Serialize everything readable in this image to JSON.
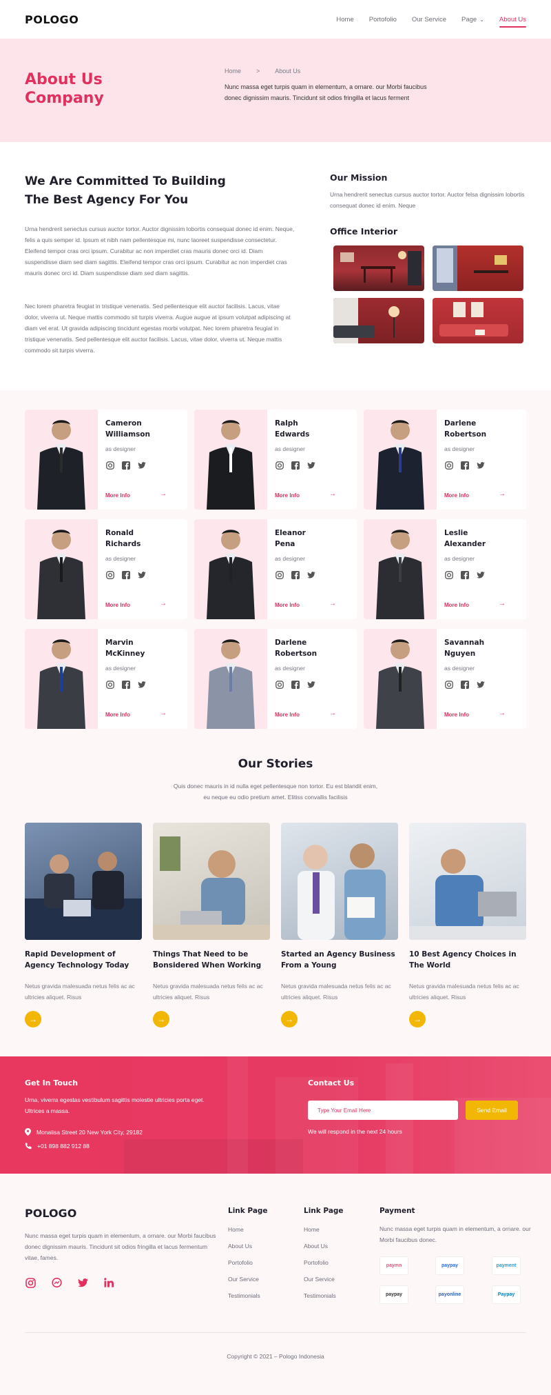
{
  "header": {
    "logo": "POLOGO",
    "nav": [
      {
        "label": "Home"
      },
      {
        "label": "Portofolio"
      },
      {
        "label": "Our Service"
      },
      {
        "label": "Page"
      },
      {
        "label": "About Us"
      }
    ]
  },
  "hero": {
    "title_line1": "About Us",
    "title_line2": "Company",
    "breadcrumb": [
      "Home",
      ">",
      "About Us"
    ],
    "text": "Nunc massa eget turpis quam in elementum, a ornare. our Morbi faucibus donec dignissim mauris. Tincidunt sit odios fringilla et lacus ferment"
  },
  "about": {
    "heading_line1": "We Are Committed To Building",
    "heading_line2": "The Best Agency For You",
    "para1": "Urna hendrerit senectus cursus auctor tortor. Auctor dignissim lobortis consequat donec id enim. Neque, felis a quis semper id. Ipsum et nibh nam pellentesque mi, nunc laoreet suspendisse consectetur. Eleifend tempor cras orci ipsum. Curabitur ac non imperdiet cras mauris donec orci id. Diam suspendisse diam sed diam sagittis. Eleifend tempor cras orci ipsum. Curabitur ac non imperdiet cras mauris donec orci id. Diam suspendisse diam sed diam sagittis.",
    "para2": "Nec lorem pharetra feugiat in tristique venenatis. Sed pellentesque elit auctor facilisis. Lacus, vitae dolor, viverra ut. Neque mattis commodo sit turpis viverra. Augue augue at ipsum volutpat adipiscing at diam vel erat. Ut gravida adipiscing tincidunt egestas morbi volutpat. Nec lorem pharetra feugiat in tristique venenatis. Sed pellentesque elit auctor facilisis. Lacus, vitae dolor, viverra ut. Neque mattis commodo sit turpis viverra.",
    "mission_heading": "Our Mission",
    "mission_text": "Urna hendrerit senectus cursus auctor tortor. Auctor felsa dignissim lobortis consequat donec id enim. Neque",
    "office_heading": "Office Interior"
  },
  "team": [
    {
      "name_line1": "Cameron",
      "name_line2": "Williamson",
      "role": "as designer",
      "more": "More Info"
    },
    {
      "name_line1": "Ralph",
      "name_line2": "Edwards",
      "role": "as designer",
      "more": "More Info"
    },
    {
      "name_line1": "Darlene",
      "name_line2": "Robertson",
      "role": "as designer",
      "more": "More Info"
    },
    {
      "name_line1": "Ronald",
      "name_line2": "Richards",
      "role": "as designer",
      "more": "More Info"
    },
    {
      "name_line1": "Eleanor",
      "name_line2": "Pena",
      "role": "as designer",
      "more": "More Info"
    },
    {
      "name_line1": "Leslie",
      "name_line2": "Alexander",
      "role": "as designer",
      "more": "More Info"
    },
    {
      "name_line1": "Marvin",
      "name_line2": "McKinney",
      "role": "as designer",
      "more": "More Info"
    },
    {
      "name_line1": "Darlene",
      "name_line2": "Robertson",
      "role": "as designer",
      "more": "More Info"
    },
    {
      "name_line1": "Savannah",
      "name_line2": "Nguyen",
      "role": "as designer",
      "more": "More Info"
    }
  ],
  "stories": {
    "heading": "Our Stories",
    "sub": "Quis donec mauris in id nulla eget pellentesque non tortor. Eu est blandit enim, eu neque eu odio pretium amet. Elitiss convallis facilisis",
    "items": [
      {
        "title": "Rapid Development of Agency Technology Today",
        "text": "Netus gravida malesuada netus felis ac ac ultricies aliquet. Risus"
      },
      {
        "title": "Things That Need to be Bonsidered When Working",
        "text": "Netus gravida malesuada netus felis ac ac ultricies aliquet. Risus"
      },
      {
        "title": "Started an Agency Business From a Young",
        "text": "Netus gravida malesuada netus felis ac ac ultricies aliquet. Risus"
      },
      {
        "title": "10 Best Agency Choices in The World",
        "text": "Netus gravida malesuada netus felis ac ac ultricies aliquet. Risus"
      }
    ]
  },
  "contact": {
    "get_in_touch": "Get In Touch",
    "text": "Urna, viverra egestas vestibulum sagittis molestie ultricies porta eget. Ultrices a massa.",
    "address": "Monalisa Street 20 New York City, 29182",
    "phone": "+01 898 882 912 88",
    "contact_heading": "Contact Us",
    "email_placeholder": "Type Your Email Here",
    "send": "Send Email",
    "respond": "We will respond in the next 24 hours"
  },
  "footer": {
    "logo": "POLOGO",
    "text": "Nunc massa eget turpis quam in elementum, a ornare. our Morbi faucibus donec dignissim mauris. Tincidunt sit odios fringilla et lacus fermentum vitae, fames.",
    "col1_heading": "Link Page",
    "col1": [
      "Home",
      "About Us",
      "Portofolio",
      "Our Service",
      "Testimonials"
    ],
    "col2_heading": "Link Page",
    "col2": [
      "Home",
      "About Us",
      "Portofolio",
      "Our Service",
      "Testimonials"
    ],
    "payment_heading": "Payment",
    "payment_text": "Nunc massa eget turpis quam in elementum, a ornare. our Morbi faucibus donec.",
    "payments": [
      "paymn",
      "paypay",
      "payment",
      "paypay",
      "payonline",
      "Paypay"
    ],
    "copyright": "Copyright © 2021 – Pologo Indonesia"
  },
  "colors": {
    "accent": "#e2305e",
    "yellow": "#f2b705",
    "hero_bg": "#fce4ea"
  }
}
